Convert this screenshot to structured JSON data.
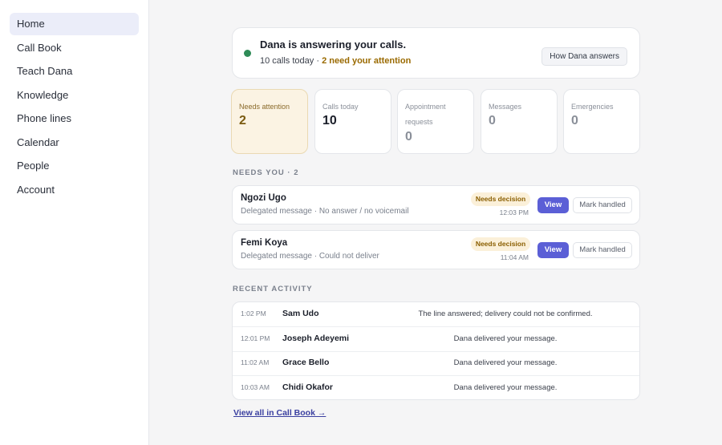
{
  "sidebar": {
    "items": [
      {
        "label": "Home",
        "active": true
      },
      {
        "label": "Call Book"
      },
      {
        "label": "Teach Dana"
      },
      {
        "label": "Knowledge"
      },
      {
        "label": "Phone lines"
      },
      {
        "label": "Calendar"
      },
      {
        "label": "People"
      },
      {
        "label": "Account"
      }
    ]
  },
  "status": {
    "title": "Dana is answering your calls.",
    "calls_today": "10 calls today",
    "separator": "·",
    "attention": "2 need your attention",
    "how_button": "How Dana answers",
    "dot_color": "#2e8b57"
  },
  "stats": [
    {
      "label": "Needs attention",
      "value": "2"
    },
    {
      "label": "Calls today",
      "value": "10"
    },
    {
      "label": "Appointment requests",
      "value": "0"
    },
    {
      "label": "Messages",
      "value": "0"
    },
    {
      "label": "Emergencies",
      "value": "0"
    }
  ],
  "needs_you": {
    "title": "NEEDS YOU · 2",
    "items": [
      {
        "name": "Ngozi Ugo",
        "detail": "Delegated message · No answer / no voicemail",
        "badge": "Needs decision",
        "time": "12:03 PM",
        "view_label": "View",
        "mark_label": "Mark handled"
      },
      {
        "name": "Femi Koya",
        "detail": "Delegated message · Could not deliver",
        "badge": "Needs decision",
        "time": "11:04 AM",
        "view_label": "View",
        "mark_label": "Mark handled"
      }
    ]
  },
  "recent": {
    "title": "RECENT ACTIVITY",
    "rows": [
      {
        "time": "1:02 PM",
        "name": "Sam Udo",
        "message": "The line answered; delivery could not be confirmed."
      },
      {
        "time": "12:01 PM",
        "name": "Joseph Adeyemi",
        "message": "Dana delivered your message."
      },
      {
        "time": "11:02 AM",
        "name": "Grace Bello",
        "message": "Dana delivered your message."
      },
      {
        "time": "10:03 AM",
        "name": "Chidi Okafor",
        "message": "Dana delivered your message."
      }
    ],
    "view_all": "View all in Call Book →"
  },
  "colors": {
    "accent": "#5b5fd6",
    "attention": "#9a6a00",
    "badge_bg": "#fbf0d9"
  }
}
